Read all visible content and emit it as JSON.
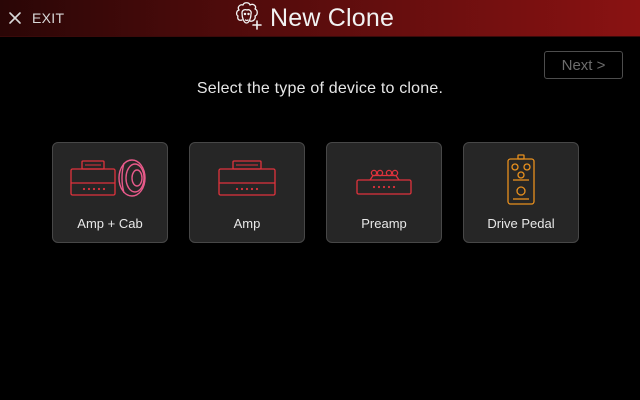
{
  "header": {
    "exit_label": "EXIT",
    "title": "New Clone",
    "logo_icon": "sheep-clone-icon",
    "gradient_colors": [
      "#2a0606",
      "#8a1212"
    ]
  },
  "toolbar": {
    "next_label": "Next >",
    "next_enabled": false
  },
  "main": {
    "prompt": "Select the type of device to clone."
  },
  "device_types": [
    {
      "label": "Amp + Cab",
      "icon": "amp-cab-icon",
      "color": "#e0323c"
    },
    {
      "label": "Amp",
      "icon": "amp-head-icon",
      "color": "#e0323c"
    },
    {
      "label": "Preamp",
      "icon": "preamp-icon",
      "color": "#e0323c"
    },
    {
      "label": "Drive Pedal",
      "icon": "drive-pedal-icon",
      "color": "#e8901e"
    }
  ],
  "colors": {
    "background": "#000000",
    "card_background": "#262626",
    "card_border": "#474747",
    "accent_red": "#e0323c",
    "accent_pink": "#e85a8a",
    "accent_orange": "#e8901e",
    "disabled_text": "#6c6c6c"
  }
}
